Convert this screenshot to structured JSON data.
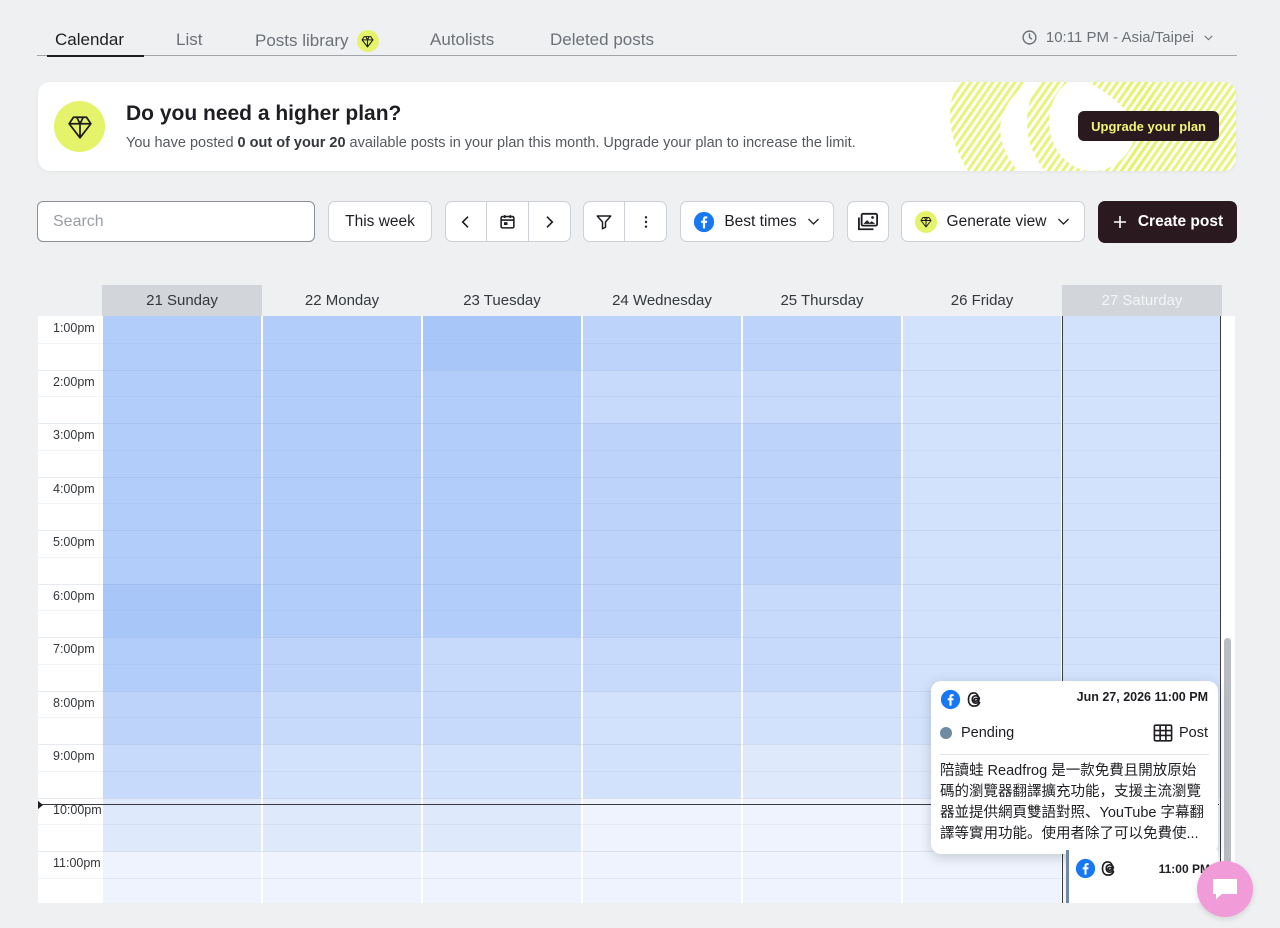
{
  "tabs": [
    {
      "label": "Calendar",
      "active": true
    },
    {
      "label": "List"
    },
    {
      "label": "Posts library",
      "badge": "gem-icon"
    },
    {
      "label": "Autolists"
    },
    {
      "label": "Deleted posts"
    }
  ],
  "timezone": {
    "label": "10:11 PM - Asia/Taipei"
  },
  "banner": {
    "title": "Do you need a higher plan?",
    "desc_prefix": "You have posted ",
    "desc_bold": "0 out of your 20",
    "desc_suffix": " available posts in your plan this month. Upgrade your plan to increase the limit.",
    "button": "Upgrade your plan"
  },
  "toolbar": {
    "search_placeholder": "Search",
    "this_week": "This week",
    "best_times": "Best times",
    "generate_view": "Generate view",
    "create_post": "Create post"
  },
  "calendar": {
    "days": [
      "21 Sunday",
      "22 Monday",
      "23 Tuesday",
      "24 Wednesday",
      "25 Thursday",
      "26 Friday",
      "27 Saturday"
    ],
    "times": [
      "1:00pm",
      "2:00pm",
      "3:00pm",
      "4:00pm",
      "5:00pm",
      "6:00pm",
      "7:00pm",
      "8:00pm",
      "9:00pm",
      "10:00pm",
      "11:00pm"
    ]
  },
  "post_card": {
    "datetime": "Jun 27, 2026 11:00 PM",
    "status": "Pending",
    "type": "Post",
    "text": "陪讀蛙 Readfrog 是一款免費且開放原始碼的瀏覽器翻譯擴充功能，支援主流瀏覽器並提供網頁雙語對照、YouTube 字幕翻譯等實用功能。使用者除了可以免費使..."
  },
  "mini_card": {
    "time": "11:00 PM"
  },
  "colors": {
    "accent_lime": "#e4f36a",
    "dark": "#2a1a1f",
    "status_pending": "#6f8aa1"
  }
}
